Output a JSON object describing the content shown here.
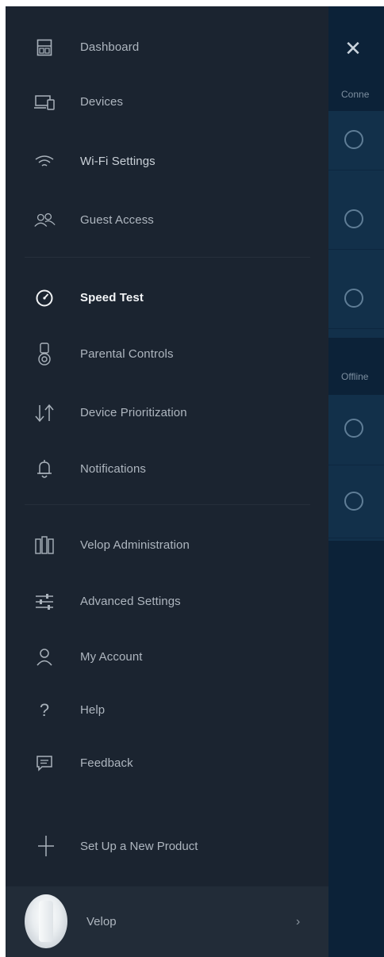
{
  "menu": {
    "items": [
      {
        "label": "Dashboard",
        "icon": "dashboard-icon"
      },
      {
        "label": "Devices",
        "icon": "devices-icon"
      },
      {
        "label": "Wi-Fi Settings",
        "icon": "wifi-icon"
      },
      {
        "label": "Guest Access",
        "icon": "guest-access-icon"
      },
      {
        "label": "Speed Test",
        "icon": "speedometer-icon",
        "active": true
      },
      {
        "label": "Parental Controls",
        "icon": "parental-controls-icon"
      },
      {
        "label": "Device Prioritization",
        "icon": "prioritization-arrows-icon"
      },
      {
        "label": "Notifications",
        "icon": "bell-icon"
      },
      {
        "label": "Velop Administration",
        "icon": "velop-admin-icon"
      },
      {
        "label": "Advanced Settings",
        "icon": "sliders-icon"
      },
      {
        "label": "My Account",
        "icon": "person-icon"
      },
      {
        "label": "Help",
        "icon": "question-icon"
      },
      {
        "label": "Feedback",
        "icon": "feedback-icon"
      }
    ],
    "setup_label": "Set Up a New Product",
    "node_label": "Velop"
  },
  "background": {
    "connected_header": "Conne",
    "offline_header": "Offline"
  },
  "colors": {
    "drawer_bg": "#1b2430",
    "background_panel": "#0c2238",
    "active_text": "#f2f4f6",
    "inactive_text": "#aeb6bf"
  }
}
